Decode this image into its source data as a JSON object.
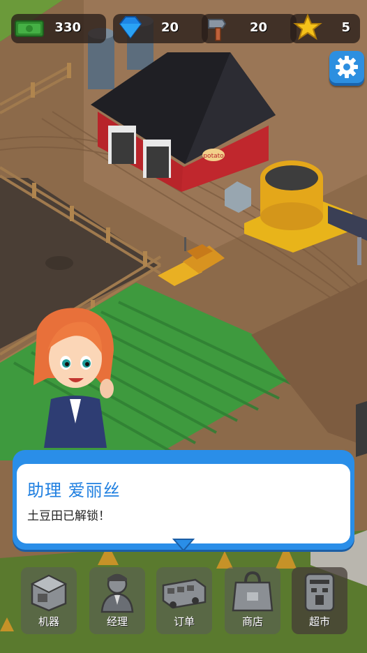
{
  "hud": {
    "cash": {
      "icon": "cash-icon",
      "value": "330"
    },
    "gems": {
      "icon": "gem-icon",
      "value": "20"
    },
    "hammers": {
      "icon": "hammer-icon",
      "value": "20"
    },
    "stars": {
      "icon": "star-icon",
      "value": "5"
    }
  },
  "settings": {
    "icon": "gear-icon"
  },
  "dialog": {
    "speaker": "助理 爱丽丝",
    "message": "土豆田已解锁！"
  },
  "barn_sign": "potato",
  "nav": [
    {
      "label": "机器",
      "icon": "machine-icon"
    },
    {
      "label": "经理",
      "icon": "manager-icon"
    },
    {
      "label": "订单",
      "icon": "truck-icon"
    },
    {
      "label": "商店",
      "icon": "shopping-bag-icon"
    },
    {
      "label": "超市",
      "icon": "supermarket-icon"
    }
  ],
  "colors": {
    "accent_blue": "#2a8ee8",
    "dialog_name": "#1f7fe0",
    "field_green": "#3e9a3e",
    "barn_red": "#c0272d"
  }
}
